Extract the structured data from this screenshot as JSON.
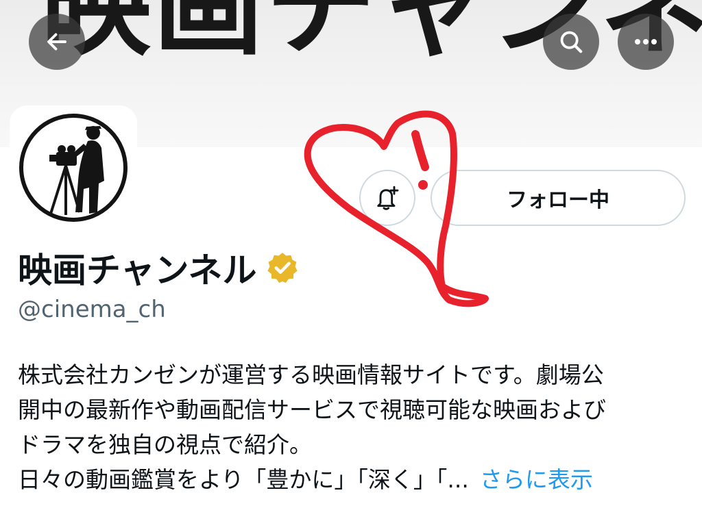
{
  "banner": {
    "text": "映画チャンネル"
  },
  "nav": {
    "back_icon": "arrow-left-icon",
    "search_icon": "search-icon",
    "more_icon": "more-dots-icon"
  },
  "profile": {
    "avatar_icon": "camera-operator-logo",
    "display_name": "映画チャンネル",
    "verified_icon": "verified-gold-badge-icon",
    "verified_color": "#e8b82a",
    "handle": "@cinema_ch"
  },
  "actions": {
    "notify_icon": "bell-plus-icon",
    "follow_label": "フォロー中"
  },
  "bio": {
    "lines": [
      "株式会社カンゼンが運営する映画情報サイトです。劇場公",
      "開中の最新作や動画配信サービスで視聴可能な映画および",
      "ドラマを独自の視点で紹介。",
      "日々の動画鑑賞をより「豊かに」「深く」「..."
    ],
    "show_more": "さらに表示",
    "link_color": "#1d9bf0"
  },
  "annotation": {
    "heart_color": "#e8222d"
  }
}
